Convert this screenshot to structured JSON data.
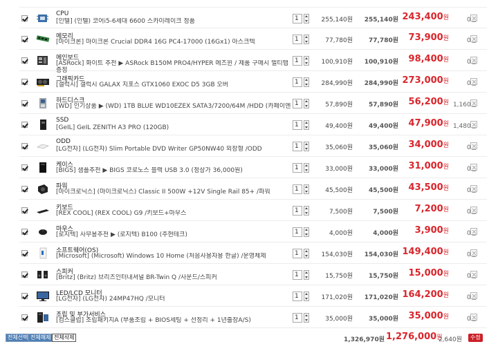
{
  "cart": {
    "items": [
      {
        "category": "CPU",
        "desc": "[인텔] (인텔) 코어i5-6세대 6600 스카이레이크 정품",
        "qty": "1",
        "unit_price": "255,140원",
        "subtotal": "255,140원",
        "sale": "243,400",
        "won": "원",
        "points": "0원",
        "icon": "cpu-icon"
      },
      {
        "category": "메모리",
        "desc": "[마이크론] 마이크론 Crucial DDR4 16G PC4-17000 (16Gx1) 아스크텍",
        "qty": "1",
        "unit_price": "77,780원",
        "subtotal": "77,780원",
        "sale": "73,900",
        "won": "원",
        "points": "0원",
        "icon": "memory-icon"
      },
      {
        "category": "메인보드",
        "desc": "[ASRock] 화이트 추천 ▶ ASRock B150M PRO4/HYPER 에즈윈 / 제품 구매시 멀티탭 증정",
        "qty": "1",
        "unit_price": "100,910원",
        "subtotal": "100,910원",
        "sale": "98,400",
        "won": "원",
        "points": "0원",
        "icon": "motherboard-icon"
      },
      {
        "category": "그래픽카드",
        "desc": "[갤럭시] 갤럭시 GALAX 지포스 GTX1060 EXOC D5 3GB 오버",
        "qty": "1",
        "unit_price": "284,990원",
        "subtotal": "284,990원",
        "sale": "273,000",
        "won": "원",
        "points": "0원",
        "icon": "graphics-card-icon"
      },
      {
        "category": "하드디스크",
        "desc": "[WD] 인기상품 ▶ (WD) 1TB BLUE WD10EZEX SATA3/7200/64M /HDD (카페이엔트)",
        "qty": "1",
        "unit_price": "57,890원",
        "subtotal": "57,890원",
        "sale": "56,200",
        "won": "원",
        "points": "1,160원",
        "icon": "hard-disk-icon"
      },
      {
        "category": "SSD",
        "desc": "[GeIL] GeIL ZENITH A3 PRO (120GB)",
        "qty": "1",
        "unit_price": "49,400원",
        "subtotal": "49,400원",
        "sale": "47,900",
        "won": "원",
        "points": "1,480원",
        "icon": "ssd-icon"
      },
      {
        "category": "ODD",
        "desc": "[LG전자] (LG전자) Slim Portable DVD Writer GP50NW40 외장형 /ODD",
        "qty": "1",
        "unit_price": "35,060원",
        "subtotal": "35,060원",
        "sale": "34,000",
        "won": "원",
        "points": "0원",
        "icon": "odd-icon"
      },
      {
        "category": "케이스",
        "desc": "[BIGS] 샘플추천 ▶ BIGS 코로노스 블랙 USB 3.0 (정상가 36,000원)",
        "qty": "1",
        "unit_price": "33,000원",
        "subtotal": "33,000원",
        "sale": "31,000",
        "won": "원",
        "points": "0원",
        "icon": "case-icon"
      },
      {
        "category": "파워",
        "desc": "[마이크로닉스] (마이크로닉스) Classic II 500W +12V Single Rail 85+ /파워",
        "qty": "1",
        "unit_price": "45,500원",
        "subtotal": "45,500원",
        "sale": "43,500",
        "won": "원",
        "points": "0원",
        "icon": "power-supply-icon"
      },
      {
        "category": "키보드",
        "desc": "[REX COOL] (REX COOL) G9 /키보드+마우스",
        "qty": "1",
        "unit_price": "7,500원",
        "subtotal": "7,500원",
        "sale": "7,200",
        "won": "원",
        "points": "0원",
        "icon": "keyboard-icon"
      },
      {
        "category": "마우스",
        "desc": "[로지텍] 사무용추천 ▶ (로지텍) B100 (주현테크)",
        "qty": "1",
        "unit_price": "4,000원",
        "subtotal": "4,000원",
        "sale": "3,900",
        "won": "원",
        "points": "0원",
        "icon": "mouse-icon"
      },
      {
        "category": "소프트웨어(OS)",
        "desc": "[Microsoft] (Microsoft) Windows 10 Home (처음사용자용 한글) /운영체제",
        "qty": "1",
        "unit_price": "154,030원",
        "subtotal": "154,030원",
        "sale": "149,400",
        "won": "원",
        "points": "0원",
        "icon": "software-icon"
      },
      {
        "category": "스피커",
        "desc": "[Britz] (Britz) 브리츠인터내셔널 BR-Twin Q /사운드/스피커",
        "qty": "1",
        "unit_price": "15,750원",
        "subtotal": "15,750원",
        "sale": "15,000",
        "won": "원",
        "points": "0원",
        "icon": "speaker-icon"
      },
      {
        "category": "LED/LCD 모니터",
        "desc": "[LG전자] (LG전자) 24MP47HQ /모니터",
        "qty": "1",
        "unit_price": "171,020원",
        "subtotal": "171,020원",
        "sale": "164,200",
        "won": "원",
        "points": "0원",
        "icon": "monitor-icon"
      },
      {
        "category": "조립 및 부가서비스",
        "desc": "[컴스클럽] 조립패키지A (부품조립 + BIOS세팅 + 선정리 + 1년출장A/S)",
        "qty": "1",
        "unit_price": "35,000원",
        "subtotal": "35,000원",
        "sale": "35,000",
        "won": "원",
        "points": "0원",
        "icon": "assembly-service-icon"
      }
    ]
  },
  "footer": {
    "select_all": "전체선택",
    "deselect_all": "전체해제",
    "delete_all": "전체삭제",
    "total_subtotal": "1,326,970원",
    "total_sale": "1,276,000",
    "won": "원",
    "total_points": "2,640원",
    "modify_label": "수정"
  },
  "colors": {
    "accent_red": "#d8262c",
    "button_blue": "#4f7fb5"
  }
}
